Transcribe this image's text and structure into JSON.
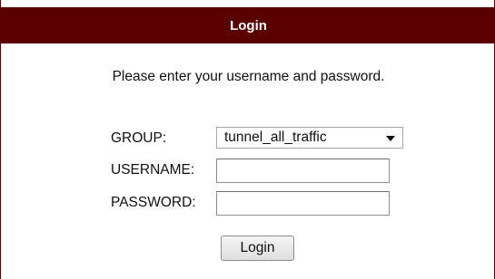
{
  "header": {
    "title": "Login"
  },
  "form": {
    "instructions": "Please enter your username and password.",
    "group": {
      "label": "GROUP:",
      "selected": "tunnel_all_traffic"
    },
    "username": {
      "label": "USERNAME:",
      "value": ""
    },
    "password": {
      "label": "PASSWORD:",
      "value": ""
    },
    "submit_label": "Login"
  }
}
